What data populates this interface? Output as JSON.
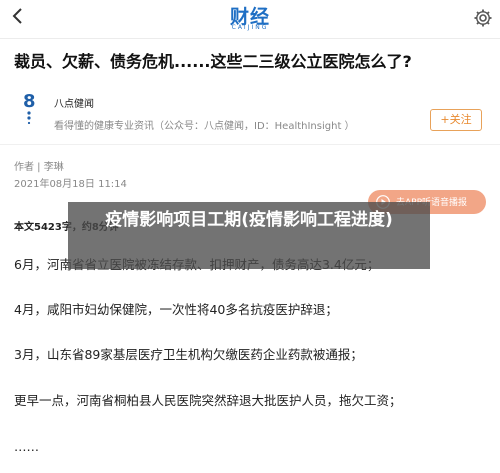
{
  "header": {
    "logo_cn": "财经",
    "logo_en": "CAIJING",
    "back_icon": "chevron-left-icon",
    "right_icon": "gear-icon"
  },
  "article": {
    "title": "裁员、欠薪、债务危机......这些二三级公立医院怎么了?",
    "source_name": "八点健闻",
    "source_desc": "看得懂的健康专业资讯（公众号：八点健闻，ID：HealthInsight ）",
    "follow_label": "+关注",
    "author": "作者 | 李琳",
    "datetime": "2021年08月18日 11:14",
    "audio_label": "去APP听语音播报",
    "word_count": "本文5423字，约8分钟",
    "paragraphs": [
      "6月，河南省省立医院被冻结存款、扣押财产，债务高达3.4亿元；",
      "4月，咸阳市妇幼保健院，一次性将40多名抗疫医护辞退；",
      "3月，山东省89家基层医疗卫生机构欠缴医药企业药款被通报；",
      "更早一点，河南省桐柏县人民医院突然辞退大批医护人员，拖欠工资；",
      "……"
    ]
  },
  "overlay": {
    "text": "疫情影响项目工期(疫情影响工程进度)"
  },
  "colors": {
    "brand": "#1f6fc4",
    "follow": "#e88a30",
    "audio_pill": "#f2a687"
  }
}
